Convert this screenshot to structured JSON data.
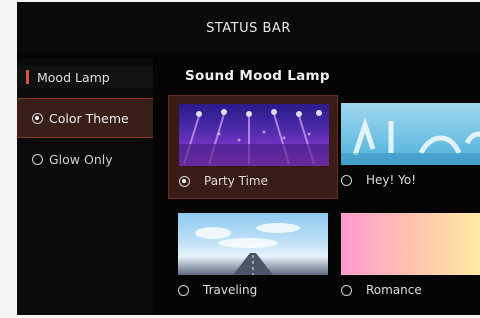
{
  "status_bar": {
    "label": "STATUS BAR"
  },
  "sidebar": {
    "header": "Mood Lamp",
    "items": [
      {
        "label": "Color Theme",
        "selected": true
      },
      {
        "label": "Glow Only",
        "selected": false
      }
    ]
  },
  "main": {
    "title": "Sound Mood Lamp",
    "themes": [
      {
        "label": "Party Time",
        "selected": true,
        "thumbnail": "stage-lights-image"
      },
      {
        "label": "Hey! Yo!",
        "selected": false,
        "thumbnail": "blue-abstract-image"
      },
      {
        "label": "Traveling",
        "selected": false,
        "thumbnail": "sky-road-image"
      },
      {
        "label": "Romance",
        "selected": false,
        "thumbnail": "pink-gradient-image"
      }
    ]
  },
  "colors": {
    "accent": "#d8533a",
    "selected_bg": "#3a1e18",
    "background": "#050505"
  }
}
